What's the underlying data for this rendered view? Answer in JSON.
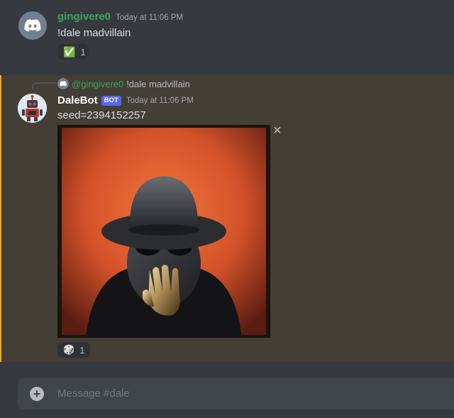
{
  "colors": {
    "background": "#36393f",
    "highlight_background": "#433e36",
    "highlight_border": "#faa81a",
    "user_name_green": "#3ba55d",
    "bot_tag_blue": "#5865f2"
  },
  "messages": [
    {
      "author": "gingivere0",
      "timestamp": "Today at 11:06 PM",
      "avatar_icon": "discord-logo-icon",
      "content": "!dale madvillain",
      "reaction": {
        "emoji": "✅",
        "icon": "check-mark-icon",
        "count": "1"
      }
    },
    {
      "reply_to": {
        "author": "@gingivere0",
        "content": "!dale madvillain"
      },
      "author": "DaleBot",
      "bot_tag": "BOT",
      "timestamp": "Today at 11:06 PM",
      "avatar_icon": "robot-avatar-icon",
      "content": "seed=2394152257",
      "attachment": {
        "kind": "generated-image",
        "subject": "masked figure in bowler hat on orange background"
      },
      "reaction": {
        "emoji": "🎲",
        "icon": "dice-icon",
        "count": "1"
      }
    }
  ],
  "composer": {
    "placeholder": "Message #dale",
    "add_icon": "plus-circle-icon"
  }
}
